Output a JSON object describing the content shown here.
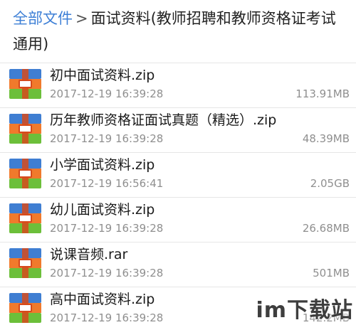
{
  "breadcrumb": {
    "root": "全部文件",
    "separator": ">",
    "current": "面试资料(教师招聘和教师资格证考试通用)"
  },
  "files": [
    {
      "name": "初中面试资料.zip",
      "date": "2017-12-19 16:39:28",
      "size": "113.91MB",
      "icon": "archive-file-icon"
    },
    {
      "name": "历年教师资格证面试真题（精选）.zip",
      "date": "2017-12-19 16:39:28",
      "size": "48.39MB",
      "icon": "archive-file-icon"
    },
    {
      "name": "小学面试资料.zip",
      "date": "2017-12-19 16:56:41",
      "size": "2.05GB",
      "icon": "archive-file-icon"
    },
    {
      "name": "幼儿面试资料.zip",
      "date": "2017-12-19 16:39:28",
      "size": "26.68MB",
      "icon": "archive-file-icon"
    },
    {
      "name": "说课音频.rar",
      "date": "2017-12-19 16:39:28",
      "size": "501MB",
      "icon": "archive-file-icon"
    },
    {
      "name": "高中面试资料.zip",
      "date": "2017-12-19 16:39:28",
      "size": "142.2MB",
      "icon": "archive-file-icon"
    }
  ],
  "watermark": {
    "text": "im下载站"
  },
  "colors": {
    "breadcrumb_root": "#3d7fd6",
    "icon_top": "#3f7ed2",
    "icon_mid": "#f07a2c",
    "icon_bottom": "#6cbf3a",
    "icon_strap": "#d64a1c"
  }
}
